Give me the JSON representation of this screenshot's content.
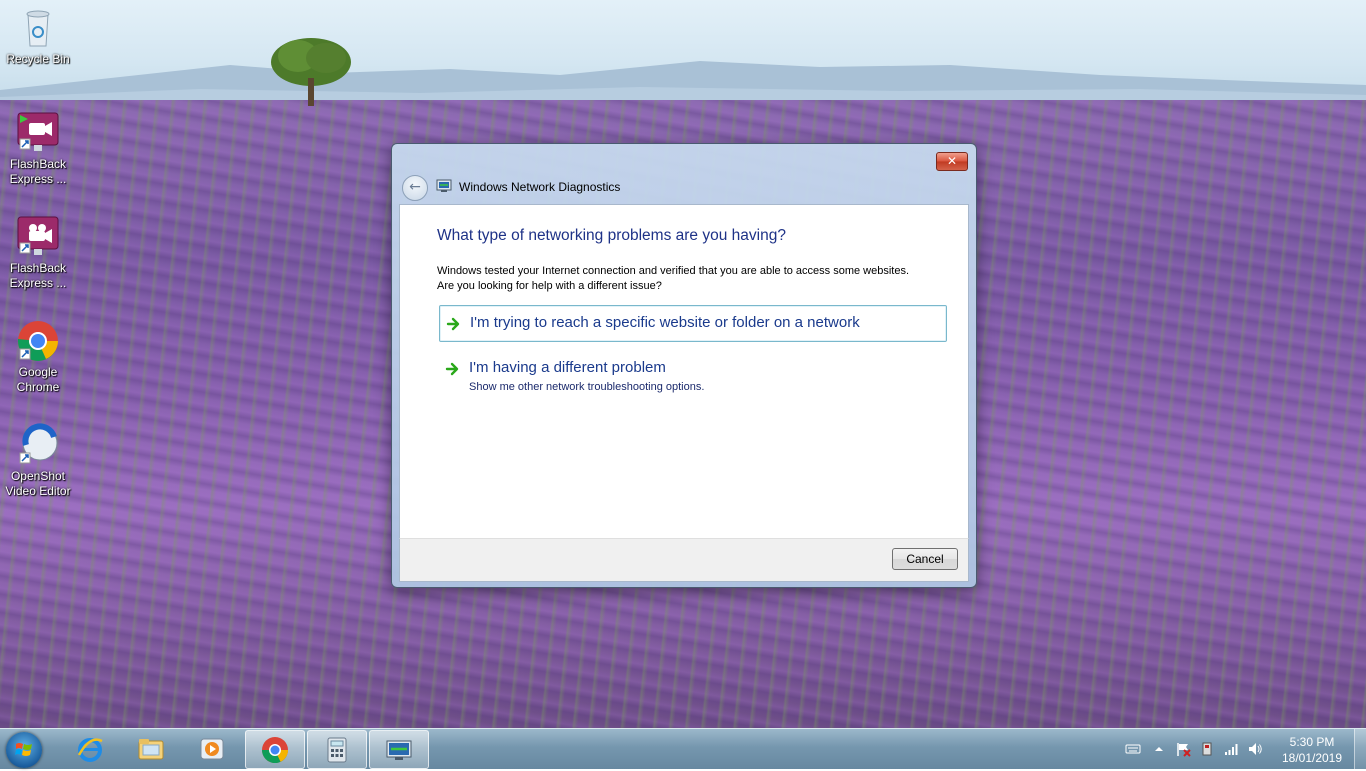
{
  "desktop": {
    "icons": [
      {
        "label_line1": "Recycle Bin",
        "label_line2": "",
        "icon": "recycle-bin-icon"
      },
      {
        "label_line1": "FlashBack",
        "label_line2": "Express ...",
        "icon": "flashback-express-icon"
      },
      {
        "label_line1": "FlashBack",
        "label_line2": "Express ...",
        "icon": "flashback-express-icon"
      },
      {
        "label_line1": "Google",
        "label_line2": "Chrome",
        "icon": "chrome-icon"
      },
      {
        "label_line1": "OpenShot",
        "label_line2": "Video Editor",
        "icon": "openshot-icon"
      }
    ]
  },
  "dialog": {
    "title": "Windows Network Diagnostics",
    "close_glyph": "✕",
    "back_glyph": "←",
    "question": "What type of networking problems are you having?",
    "info_line1": "Windows tested your Internet connection and verified that you are able to access some websites.",
    "info_line2": "Are you looking for help with a different issue?",
    "options": [
      {
        "label": "I'm trying to reach a specific website or folder on a network",
        "sub": ""
      },
      {
        "label": "I'm having a different problem",
        "sub": "Show me other network troubleshooting options."
      }
    ],
    "cancel_label": "Cancel"
  },
  "taskbar": {
    "pinned": [
      "internet-explorer-icon",
      "file-explorer-icon",
      "media-player-icon",
      "chrome-icon",
      "calculator-icon",
      "network-diagnostics-icon"
    ],
    "clock_time": "5:30 PM",
    "clock_date": "18/01/2019"
  },
  "colors": {
    "question_text": "#1e3287",
    "option_text": "#1a3a8c",
    "option_border": "#7ab8cc",
    "close_button": "#c03a22",
    "arrow_green": "#2aa81a"
  }
}
